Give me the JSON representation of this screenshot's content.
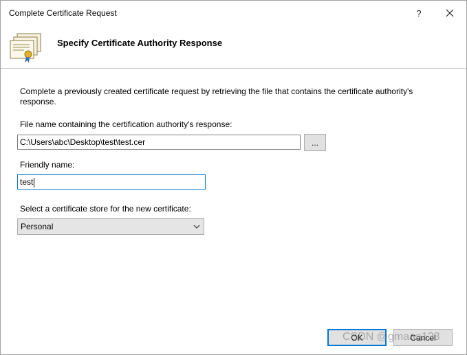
{
  "window": {
    "title": "Complete Certificate Request",
    "help_glyph": "?"
  },
  "header": {
    "title": "Specify Certificate Authority Response",
    "icon": "certificate-icon"
  },
  "form": {
    "description": "Complete a previously created certificate request by retrieving the file that contains the certificate authority's response.",
    "file_label": "File name containing the certification authority's response:",
    "file_value": "C:\\Users\\abc\\Desktop\\test\\test.cer",
    "browse_label": "...",
    "friendly_label": "Friendly name:",
    "friendly_value": "test",
    "store_label": "Select a certificate store for the new certificate:",
    "store_value": "Personal"
  },
  "footer": {
    "ok_label": "OK",
    "cancel_label": "Cancel"
  },
  "watermark": "CSDN @gmaaa123",
  "colors": {
    "focus": "#0078d7",
    "button_bg": "#e1e1e1",
    "border": "#adadad"
  }
}
